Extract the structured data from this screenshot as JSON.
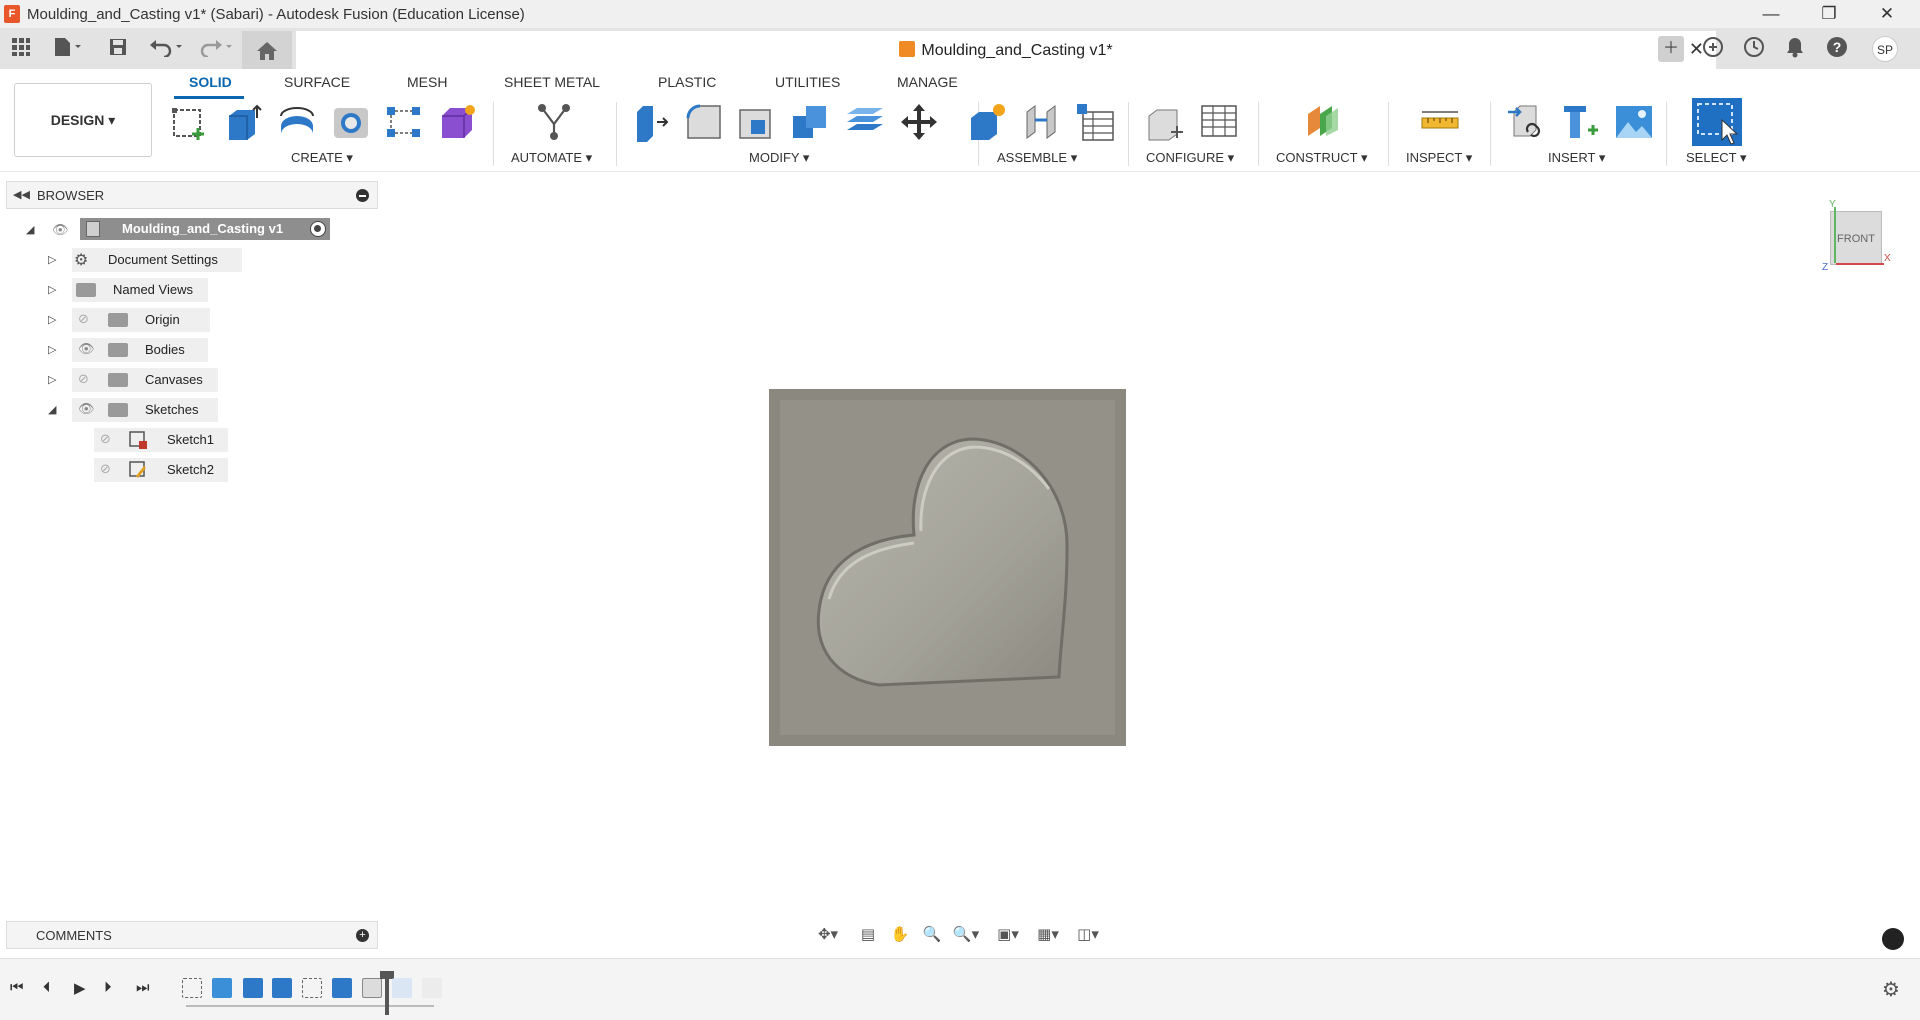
{
  "window": {
    "title": "Moulding_and_Casting v1* (Sabari) - Autodesk Fusion (Education License)",
    "logo_letter": "F",
    "controls": {
      "minimize": "—",
      "restore": "❐",
      "close": "✕"
    }
  },
  "document_tab": {
    "title": "Moulding_and_Casting v1*",
    "close": "✕"
  },
  "user": {
    "initials": "SP"
  },
  "workspace": {
    "label": "DESIGN ▾"
  },
  "ribbon": {
    "tabs": [
      "SOLID",
      "SURFACE",
      "MESH",
      "SHEET METAL",
      "PLASTIC",
      "UTILITIES",
      "MANAGE"
    ],
    "active_tab": "SOLID",
    "groups": [
      "CREATE ▾",
      "AUTOMATE ▾",
      "MODIFY ▾",
      "ASSEMBLE ▾",
      "CONFIGURE ▾",
      "CONSTRUCT ▾",
      "INSPECT ▾",
      "INSERT ▾",
      "SELECT ▾"
    ]
  },
  "browser": {
    "header": "BROWSER",
    "root": "Moulding_and_Casting v1",
    "items": [
      "Document Settings",
      "Named Views",
      "Origin",
      "Bodies",
      "Canvases",
      "Sketches"
    ],
    "sketches": [
      "Sketch1",
      "Sketch2"
    ]
  },
  "viewcube": {
    "face": "FRONT",
    "axis_x": "X",
    "axis_y": "Y",
    "axis_z": "Z"
  },
  "comments": {
    "label": "COMMENTS"
  },
  "colors": {
    "accent": "#0a66b0",
    "mold": "#8a887f",
    "heart": "#a6a59c"
  }
}
